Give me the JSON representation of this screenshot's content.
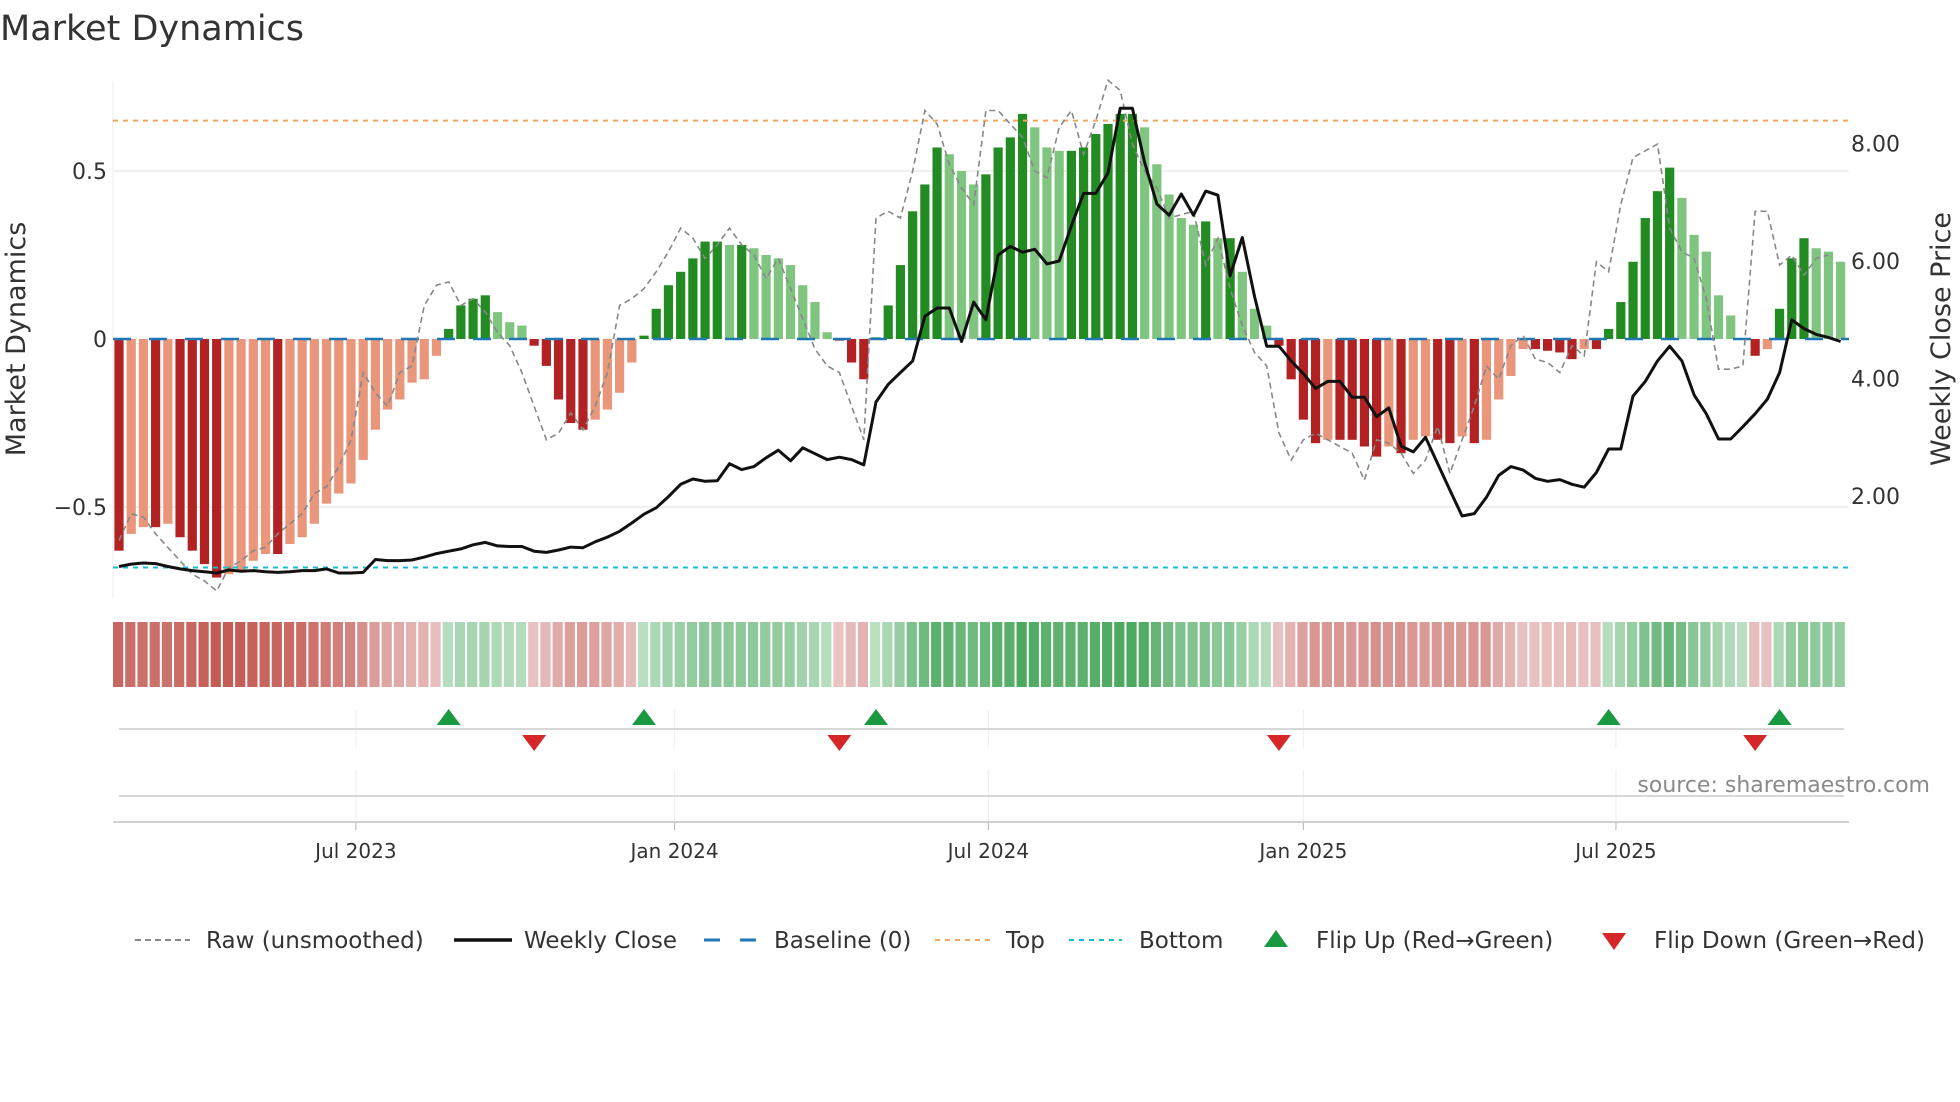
{
  "title": "Market Dynamics",
  "source": "source: sharemaestro.com",
  "colors": {
    "dark_green": "#228b22",
    "light_green": "#7fc47f",
    "dark_red": "#b22222",
    "light_red": "#e9967a",
    "baseline": "#1f77b4",
    "top": "#f0a860",
    "bottom": "#17becf",
    "flip_up": "#1a9a40",
    "flip_down": "#d62728",
    "raw": "#888888",
    "close": "#111111"
  },
  "chart_data": {
    "type": "bar",
    "title": "Market Dynamics",
    "ylabel": "Market Dynamics",
    "y2label": "Weekly Close Price",
    "ylim": [
      -0.78,
      0.77
    ],
    "y2lim": [
      0.48,
      9.55
    ],
    "yticks": [
      {
        "v": 0.5,
        "label": "0.5"
      },
      {
        "v": 0,
        "label": "0"
      },
      {
        "v": -0.5,
        "label": "−0.5"
      }
    ],
    "y2ticks": [
      {
        "v": 8,
        "label": "8.00"
      },
      {
        "v": 6,
        "label": "6.00"
      },
      {
        "v": 4,
        "label": "4.00"
      },
      {
        "v": 2,
        "label": "2.00"
      }
    ],
    "xticks": [
      {
        "week": 19.4,
        "label": "Jul 2023"
      },
      {
        "week": 45.5,
        "label": "Jan 2024"
      },
      {
        "week": 71.2,
        "label": "Jul 2024"
      },
      {
        "week": 97.0,
        "label": "Jan 2025"
      },
      {
        "week": 122.6,
        "label": "Jul 2025"
      }
    ],
    "top_level": 0.65,
    "bottom_level": -0.68,
    "baseline": 0,
    "momentum": [
      -0.63,
      -0.58,
      -0.56,
      -0.56,
      -0.55,
      -0.59,
      -0.63,
      -0.67,
      -0.71,
      -0.7,
      -0.69,
      -0.66,
      -0.64,
      -0.64,
      -0.61,
      -0.59,
      -0.55,
      -0.49,
      -0.46,
      -0.43,
      -0.36,
      -0.27,
      -0.21,
      -0.18,
      -0.13,
      -0.12,
      -0.05,
      0.03,
      0.1,
      0.12,
      0.13,
      0.08,
      0.05,
      0.04,
      -0.02,
      -0.08,
      -0.18,
      -0.25,
      -0.27,
      -0.24,
      -0.21,
      -0.16,
      -0.07,
      0.01,
      0.09,
      0.16,
      0.2,
      0.24,
      0.29,
      0.29,
      0.28,
      0.28,
      0.27,
      0.25,
      0.24,
      0.22,
      0.16,
      0.11,
      0.02,
      -0.005,
      -0.07,
      -0.12,
      0.005,
      0.1,
      0.22,
      0.38,
      0.46,
      0.57,
      0.55,
      0.5,
      0.46,
      0.49,
      0.57,
      0.6,
      0.67,
      0.63,
      0.57,
      0.56,
      0.56,
      0.57,
      0.61,
      0.64,
      0.67,
      0.67,
      0.63,
      0.52,
      0.43,
      0.36,
      0.34,
      0.35,
      0.3,
      0.3,
      0.2,
      0.09,
      0.04,
      -0.02,
      -0.12,
      -0.24,
      -0.31,
      -0.3,
      -0.3,
      -0.3,
      -0.32,
      -0.35,
      -0.32,
      -0.34,
      -0.3,
      -0.29,
      -0.3,
      -0.31,
      -0.29,
      -0.31,
      -0.3,
      -0.18,
      -0.11,
      -0.03,
      -0.03,
      -0.035,
      -0.04,
      -0.06,
      -0.03,
      -0.03,
      0.03,
      0.11,
      0.23,
      0.36,
      0.44,
      0.51,
      0.42,
      0.31,
      0.26,
      0.13,
      0.07,
      0.003,
      -0.05,
      -0.03,
      0.09,
      0.24,
      0.3,
      0.27,
      0.26,
      0.23
    ],
    "raw": [
      -0.6,
      -0.52,
      -0.53,
      -0.58,
      -0.62,
      -0.66,
      -0.7,
      -0.72,
      -0.75,
      -0.68,
      -0.66,
      -0.63,
      -0.62,
      -0.58,
      -0.55,
      -0.52,
      -0.46,
      -0.44,
      -0.38,
      -0.3,
      -0.1,
      -0.16,
      -0.2,
      -0.1,
      -0.08,
      0.1,
      0.16,
      0.17,
      0.1,
      0.12,
      0.08,
      0.02,
      -0.02,
      -0.1,
      -0.2,
      -0.3,
      -0.28,
      -0.22,
      -0.27,
      -0.2,
      -0.1,
      0.1,
      0.12,
      0.15,
      0.2,
      0.26,
      0.33,
      0.3,
      0.24,
      0.28,
      0.33,
      0.28,
      0.25,
      0.18,
      0.24,
      0.15,
      0.06,
      -0.03,
      -0.08,
      -0.1,
      -0.2,
      -0.3,
      0.36,
      0.38,
      0.36,
      0.5,
      0.68,
      0.64,
      0.52,
      0.45,
      0.4,
      0.68,
      0.68,
      0.64,
      0.6,
      0.5,
      0.48,
      0.63,
      0.68,
      0.55,
      0.65,
      0.77,
      0.74,
      0.58,
      0.5,
      0.45,
      0.36,
      0.37,
      0.38,
      0.22,
      0.3,
      0.15,
      0.04,
      -0.04,
      -0.08,
      -0.28,
      -0.36,
      -0.3,
      -0.28,
      -0.3,
      -0.32,
      -0.34,
      -0.42,
      -0.3,
      -0.31,
      -0.34,
      -0.4,
      -0.36,
      -0.26,
      -0.4,
      -0.3,
      -0.2,
      -0.08,
      -0.12,
      -0.02,
      0.01,
      -0.06,
      -0.07,
      -0.1,
      -0.02,
      -0.05,
      0.23,
      0.2,
      0.4,
      0.54,
      0.56,
      0.58,
      0.33,
      0.26,
      0.24,
      0.12,
      -0.09,
      -0.09,
      -0.08,
      0.38,
      0.38,
      0.22,
      0.25,
      0.19,
      0.24,
      0.25
    ],
    "weekly_close": [
      0.8,
      0.84,
      0.86,
      0.85,
      0.8,
      0.76,
      0.73,
      0.71,
      0.69,
      0.74,
      0.72,
      0.73,
      0.71,
      0.7,
      0.71,
      0.73,
      0.73,
      0.76,
      0.69,
      0.69,
      0.7,
      0.92,
      0.9,
      0.9,
      0.91,
      0.96,
      1.02,
      1.06,
      1.1,
      1.17,
      1.21,
      1.15,
      1.14,
      1.14,
      1.06,
      1.04,
      1.08,
      1.13,
      1.12,
      1.22,
      1.3,
      1.4,
      1.54,
      1.69,
      1.8,
      1.99,
      2.2,
      2.29,
      2.25,
      2.26,
      2.55,
      2.45,
      2.5,
      2.65,
      2.78,
      2.6,
      2.82,
      2.72,
      2.62,
      2.66,
      2.62,
      2.53,
      3.6,
      3.9,
      4.1,
      4.3,
      5.06,
      5.2,
      5.2,
      4.63,
      5.3,
      5.0,
      6.1,
      6.25,
      6.15,
      6.2,
      5.95,
      6.0,
      6.6,
      7.15,
      7.15,
      7.5,
      8.6,
      8.6,
      7.68,
      6.97,
      6.78,
      7.14,
      6.78,
      7.19,
      7.12,
      5.75,
      6.4,
      5.4,
      4.55,
      4.55,
      4.3,
      4.08,
      3.83,
      3.95,
      3.95,
      3.68,
      3.68,
      3.35,
      3.5,
      2.85,
      2.75,
      3.0,
      2.55,
      2.1,
      1.66,
      1.7,
      1.98,
      2.35,
      2.5,
      2.44,
      2.3,
      2.25,
      2.28,
      2.2,
      2.15,
      2.4,
      2.8,
      2.8,
      3.7,
      3.95,
      4.3,
      4.55,
      4.3,
      3.72,
      3.4,
      2.97,
      2.97,
      3.18,
      3.4,
      3.65,
      4.1,
      5.0,
      4.85,
      4.75,
      4.7,
      4.63
    ]
  },
  "legend": [
    {
      "key": "raw",
      "label": "Raw (unsmoothed)"
    },
    {
      "key": "close",
      "label": "Weekly Close"
    },
    {
      "key": "baseline",
      "label": "Baseline (0)"
    },
    {
      "key": "top",
      "label": "Top"
    },
    {
      "key": "bottom",
      "label": "Bottom"
    },
    {
      "key": "flip_up",
      "label": "Flip Up (Red→Green)"
    },
    {
      "key": "flip_down",
      "label": "Flip Down (Green→Red)"
    }
  ]
}
